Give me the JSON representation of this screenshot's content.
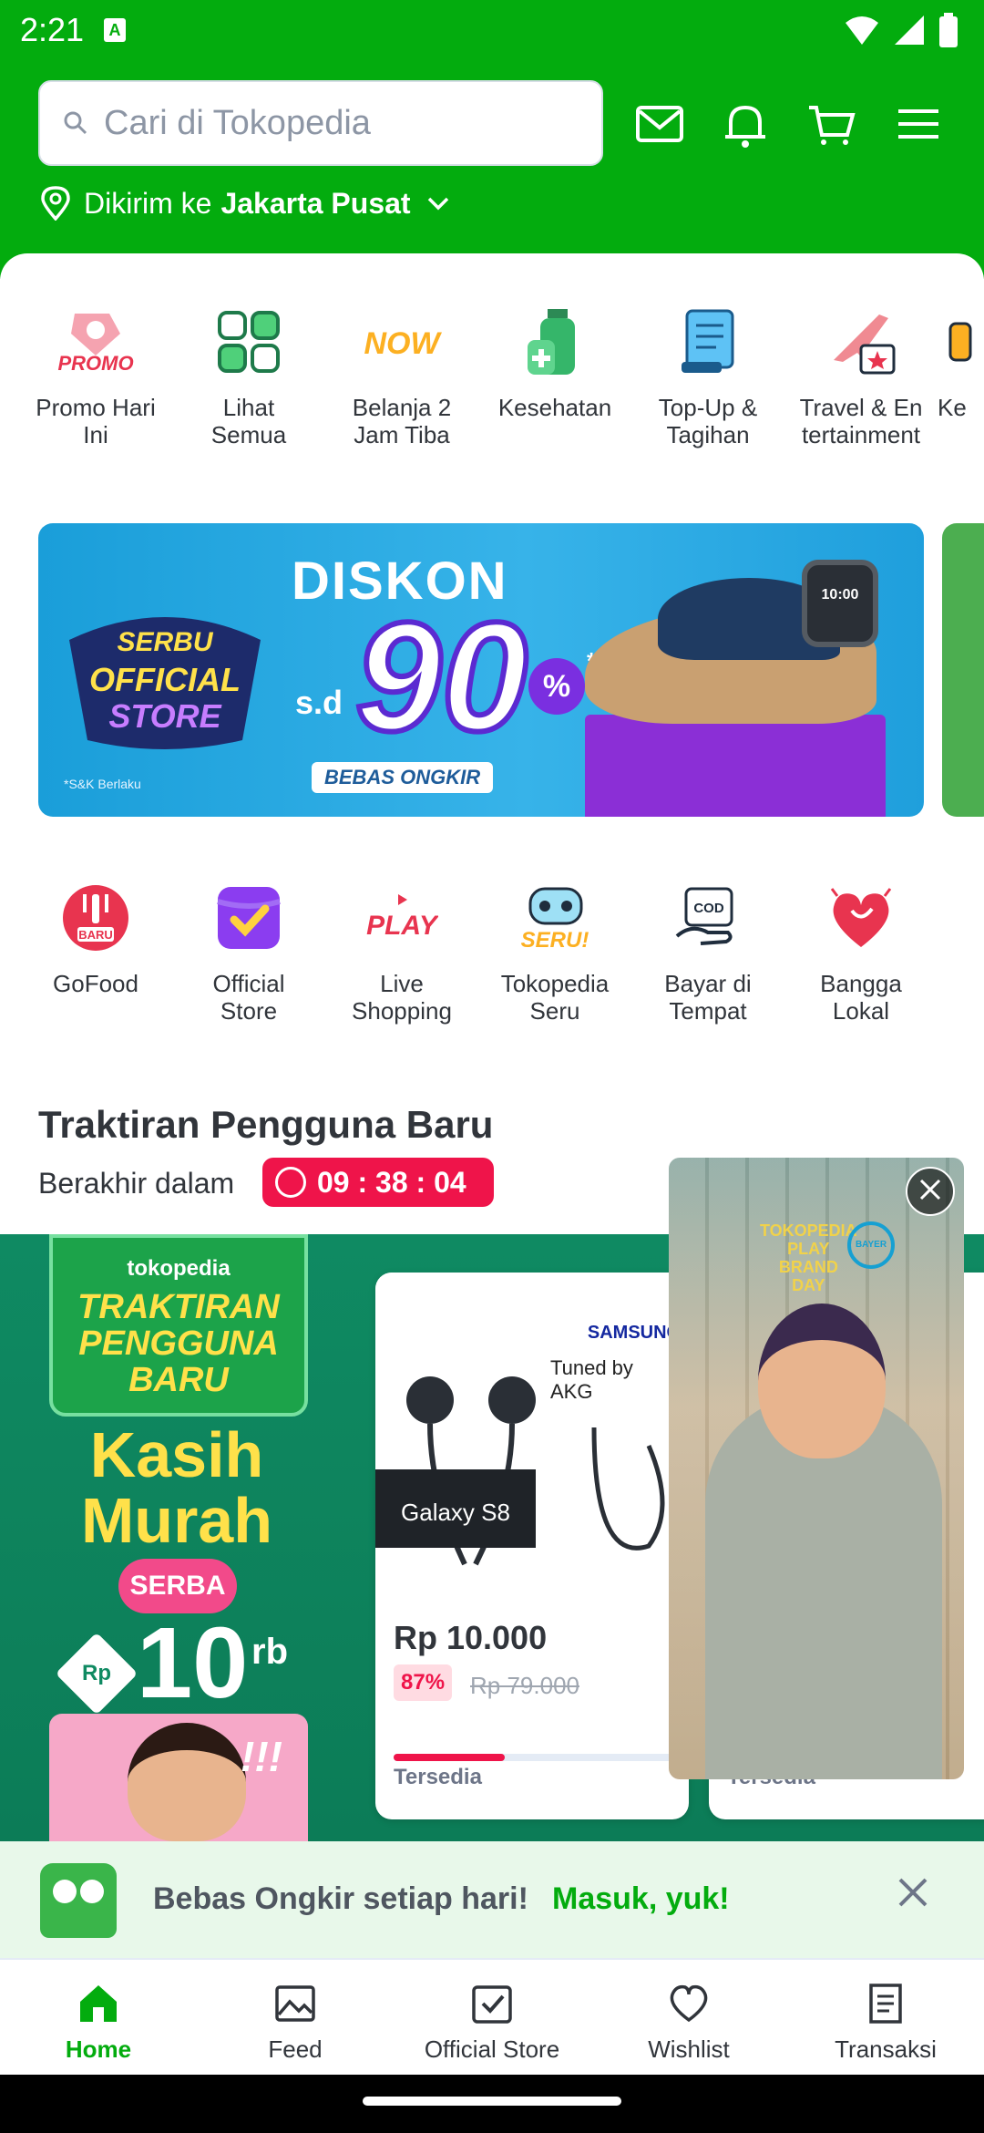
{
  "status_bar": {
    "time": "2:21",
    "a_badge": "A"
  },
  "header": {
    "search_placeholder": "Cari di Tokopedia",
    "icons": [
      "mail-icon",
      "bell-icon",
      "cart-icon",
      "menu-icon"
    ],
    "location_prefix": "Dikirim ke",
    "location_city": "Jakarta Pusat"
  },
  "categories_top": [
    {
      "label": "Promo Hari\nIni",
      "icon": "promo-icon"
    },
    {
      "label": "Lihat\nSemua",
      "icon": "grid-icon"
    },
    {
      "label": "Belanja 2\nJam Tiba",
      "icon": "now-icon"
    },
    {
      "label": "Kesehatan",
      "icon": "health-icon"
    },
    {
      "label": "Top-Up &\nTagihan",
      "icon": "bill-icon"
    },
    {
      "label": "Travel & En\ntertainment",
      "icon": "travel-icon"
    },
    {
      "label": "Ke",
      "icon": "partial-icon"
    }
  ],
  "banner": {
    "headline": "DISKON",
    "sd": "s.d",
    "amount": "90",
    "percent": "%",
    "asterisk": "*",
    "badge": "BEBAS ONGKIR",
    "note": "*S&K Berlaku",
    "brand_top": "SERBU",
    "brand_bottom": "OFFICIAL\nSTORE",
    "watch_time": "10:00"
  },
  "categories_bottom": [
    {
      "label": "GoFood",
      "icon": "gofood-icon",
      "badge": "BARU"
    },
    {
      "label": "Official\nStore",
      "icon": "official-store-icon"
    },
    {
      "label": "Live\nShopping",
      "icon": "play-icon",
      "badge": "PLAY"
    },
    {
      "label": "Tokopedia\nSeru",
      "icon": "seru-icon",
      "badge": "SERU!"
    },
    {
      "label": "Bayar di\nTempat",
      "icon": "cod-icon",
      "badge": "COD"
    },
    {
      "label": "Bangga\nLokal",
      "icon": "heart-icon"
    }
  ],
  "promo": {
    "title": "Traktiran Pengguna Baru",
    "ends_label": "Berakhir dalam",
    "timer": "09 : 38 : 04",
    "banner": {
      "brand": "tokopedia",
      "name": "TRAKTIRAN\nPENGGUNA\nBARU",
      "tagline": "Kasih\nMurah",
      "serba": "SERBA",
      "currency": "Rp",
      "amount": "10",
      "unit": "rb",
      "exclaim": "!!!"
    },
    "products": [
      {
        "price": "Rp 10.000",
        "discount": "87%",
        "old_price": "Rp 79.000",
        "stock": "Tersedia",
        "stock_fraction": 0.38,
        "brand": "SAMSUNG",
        "feature": "Tuned by\nAKG",
        "model": "Galaxy S8"
      },
      {
        "stock": "Tersedia"
      }
    ]
  },
  "video": {
    "brand_text": "TOKOPEDIA\nPLAY\nBRAND\nDAY",
    "logo_text": "BAYER"
  },
  "prompt": {
    "text": "Bebas Ongkir setiap hari!",
    "cta": "Masuk, yuk!"
  },
  "bottom_nav": [
    {
      "label": "Home",
      "icon": "home-icon",
      "active": true
    },
    {
      "label": "Feed",
      "icon": "feed-icon"
    },
    {
      "label": "Official Store",
      "icon": "official-store-nav-icon"
    },
    {
      "label": "Wishlist",
      "icon": "wishlist-icon"
    },
    {
      "label": "Transaksi",
      "icon": "transaction-icon"
    }
  ],
  "colors": {
    "brand": "#03ac0e",
    "sale": "#ef144a",
    "promo_bg": "#0f8a62"
  }
}
